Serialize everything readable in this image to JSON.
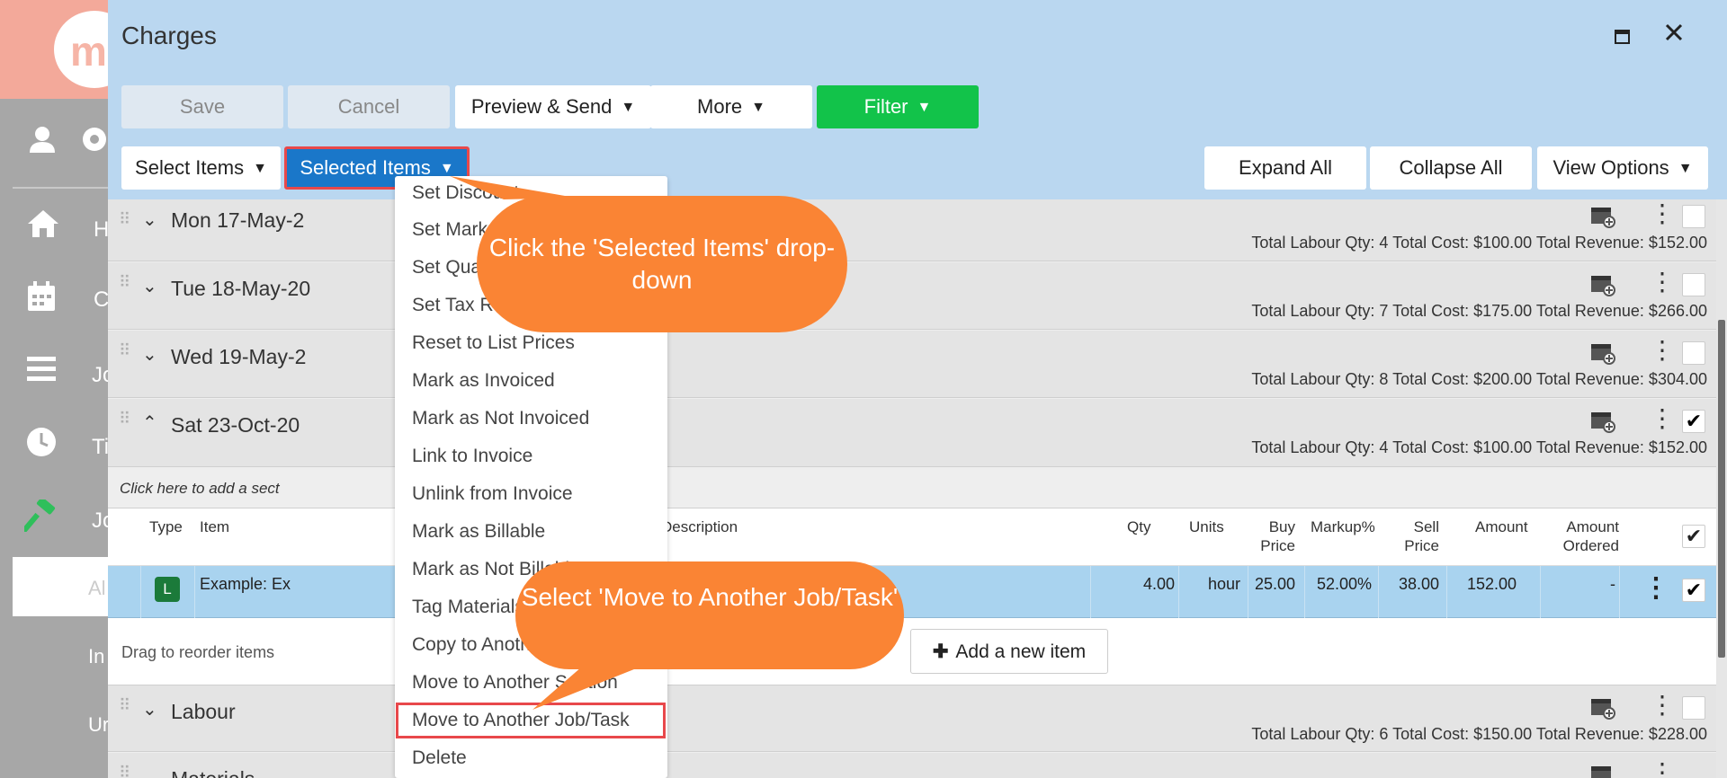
{
  "app": {
    "logo_text": "m"
  },
  "sidebar": {
    "items": [
      {
        "label": "H",
        "icon": "home-icon"
      },
      {
        "label": "C",
        "icon": "calendar-icon"
      },
      {
        "label": "Jo",
        "icon": "list-icon"
      },
      {
        "label": "Ti",
        "icon": "clock-icon"
      },
      {
        "label": "Jo",
        "icon": "hammer-icon"
      }
    ],
    "sub_items": [
      "Al",
      "In",
      "Ur"
    ]
  },
  "dialog": {
    "title": "Charges"
  },
  "toolbar": {
    "save": "Save",
    "cancel": "Cancel",
    "preview_send": "Preview & Send",
    "more": "More",
    "filter": "Filter",
    "select_items": "Select Items",
    "selected_items": "Selected Items",
    "expand_all": "Expand All",
    "collapse_all": "Collapse All",
    "view_options": "View Options"
  },
  "groups": [
    {
      "title": "Mon 17-May-2",
      "totals": "Total Labour Qty: 4   Total Cost: $100.00   Total Revenue: $152.00",
      "checked": false
    },
    {
      "title": "Tue 18-May-20",
      "totals": "Total Labour Qty: 7   Total Cost: $175.00   Total Revenue: $266.00",
      "checked": false
    },
    {
      "title": "Wed 19-May-2",
      "totals": "Total Labour Qty: 8   Total Cost: $200.00   Total Revenue: $304.00",
      "checked": false
    },
    {
      "title": "Sat 23-Oct-20",
      "totals": "Total Labour Qty: 4   Total Cost: $100.00   Total Revenue: $152.00",
      "checked": true
    }
  ],
  "add_section_hint": "Click here to add a sect",
  "table": {
    "headers": {
      "type": "Type",
      "item": "Item",
      "description": "Description",
      "qty": "Qty",
      "units": "Units",
      "buy_price_1": "Buy",
      "buy_price_2": "Price",
      "markup": "Markup%",
      "sell_price_1": "Sell",
      "sell_price_2": "Price",
      "amount": "Amount",
      "amount_ordered_1": "Amount",
      "amount_ordered_2": "Ordered"
    },
    "row": {
      "type_badge": "L",
      "item": "Example: Ex",
      "qty": "4.00",
      "units": "hour",
      "buy_price": "25.00",
      "markup": "52.00%",
      "sell_price": "38.00",
      "amount": "152.00",
      "amount_ordered": "-"
    }
  },
  "footer": {
    "drag_hint": "Drag to reorder items",
    "add_item": "Add a new item"
  },
  "lower_groups": [
    {
      "title": "Labour",
      "totals": "Total Labour Qty: 6   Total Cost: $150.00   Total Revenue: $228.00"
    },
    {
      "title": "Materials",
      "totals": ""
    }
  ],
  "menu": {
    "items": [
      "Set Discount",
      "Set Markup",
      "Set Quantity",
      "Set Tax Rate",
      "Reset to List Prices",
      "Mark as Invoiced",
      "Mark as Not Invoiced",
      "Link to Invoice",
      "Unlink from Invoice",
      "Mark as Billable",
      "Mark as Not Billable",
      "Tag Materials",
      "Copy to Another Section",
      "Move to Another Section",
      "Move to Another Job/Task",
      "Delete"
    ]
  },
  "callouts": {
    "first": "Click the 'Selected Items' drop-down",
    "second": "Select 'Move to Another Job/Task'"
  },
  "colors": {
    "callout": "#fa8434",
    "highlight": "#e8484b",
    "filter": "#12c34a",
    "selected_items": "#1a77c9",
    "titlebar": "#bad7f0"
  }
}
